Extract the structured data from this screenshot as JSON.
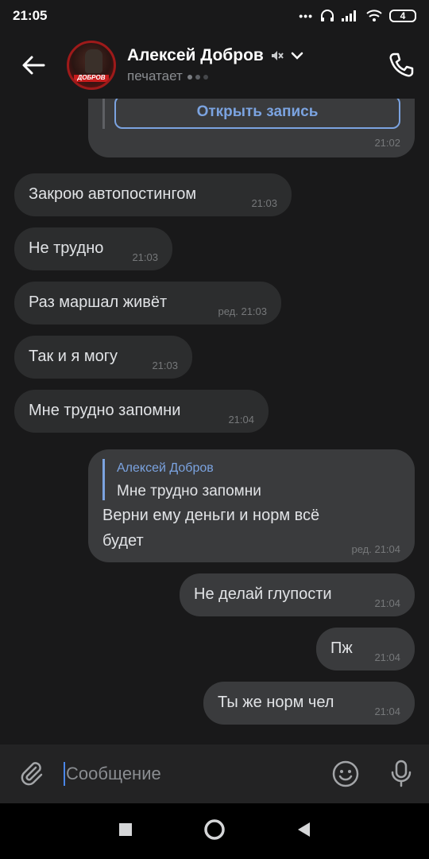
{
  "status_bar": {
    "time": "21:05",
    "battery": "4"
  },
  "header": {
    "contact_name": "Алексей Добров",
    "status": "печатает",
    "avatar_text": "ДОБРОВ"
  },
  "messages": {
    "m0": {
      "button": "Открыть запись",
      "time": "21:02"
    },
    "m1": {
      "text": "Закрою автопостингом",
      "time": "21:03"
    },
    "m2": {
      "text": "Не трудно",
      "time": "21:03"
    },
    "m3": {
      "text": "Раз маршал живёт",
      "time": "ред. 21:03"
    },
    "m4": {
      "text": "Так и я могу",
      "time": "21:03"
    },
    "m5": {
      "text": "Мне трудно запомни",
      "time": "21:04"
    },
    "m6": {
      "reply_author": "Алексей Добров",
      "reply_text": "Мне трудно запомни",
      "line1": "Верни ему деньги и норм всё",
      "line2": "будет",
      "time": "ред. 21:04"
    },
    "m7": {
      "text": "Не делай глупости",
      "time": "21:04"
    },
    "m8": {
      "text": "Пж",
      "time": "21:04"
    },
    "m9": {
      "text": "Ты же норм чел",
      "time": "21:04"
    }
  },
  "composer": {
    "placeholder": "Сообщение"
  },
  "colors": {
    "link": "#7ba3e0",
    "accent": "#4a86e8",
    "incoming": "#2c2d2e",
    "outgoing": "#3a3b3d"
  },
  "icons": [
    "back-arrow-icon",
    "mute-icon",
    "chevron-down-icon",
    "phone-icon",
    "attach-icon",
    "emoji-icon",
    "mic-icon",
    "nav-recents-icon",
    "nav-home-icon",
    "nav-back-icon"
  ]
}
